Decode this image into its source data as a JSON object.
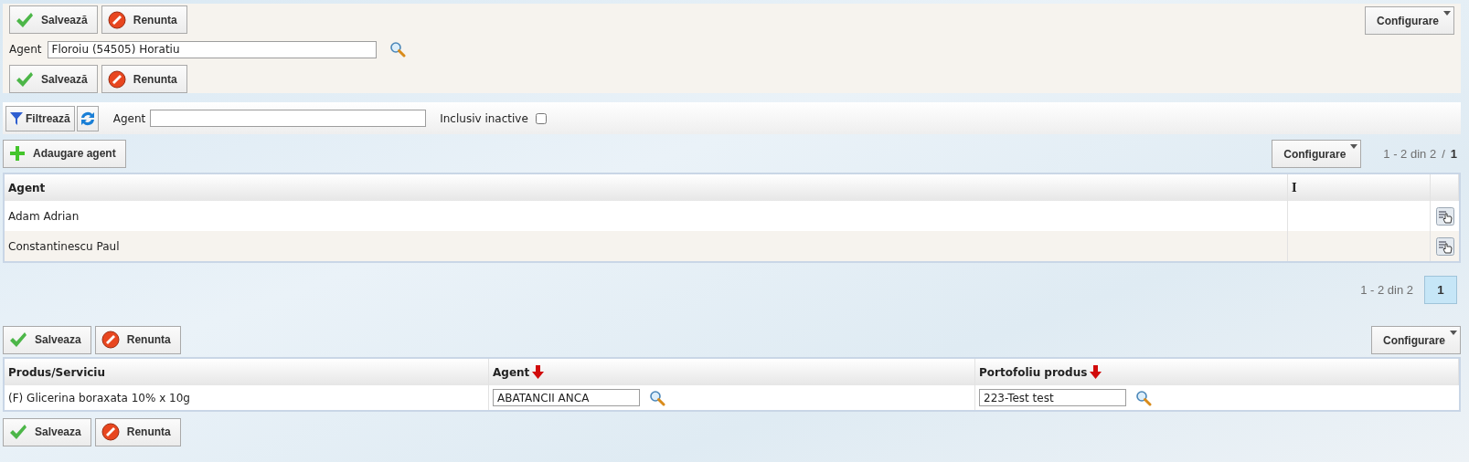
{
  "agent_form": {
    "toolbar_top": [
      {
        "kind": "save",
        "label": "Salvează"
      },
      {
        "kind": "cancel",
        "label": "Renunta"
      }
    ],
    "agent_label": "Agent",
    "agent_value": "Floroiu (54505) Horatiu",
    "configure": "Configurare",
    "toolbar_bottom": [
      {
        "kind": "save",
        "label": "Salvează"
      },
      {
        "kind": "cancel",
        "label": "Renunta"
      }
    ]
  },
  "filter_bar": {
    "filter_button": "Filtrează",
    "agent_label": "Agent",
    "inactive_label": "Inclusiv inactive",
    "inactive_checked": false
  },
  "agents_list": {
    "add_button": "Adaugare agent",
    "configure": "Configurare",
    "pager_top": {
      "range": "1 - 2 din 2",
      "separator": "/",
      "page": "1"
    },
    "columns": [
      "Agent",
      "I"
    ],
    "rows": [
      {
        "agent": "Adam Adrian"
      },
      {
        "agent": "Constantinescu Paul"
      }
    ],
    "pager_bottom": {
      "range": "1 - 2 din 2",
      "pages": [
        {
          "label": "1",
          "selected": true
        }
      ]
    }
  },
  "portfolio": {
    "toolbar_top": [
      {
        "kind": "save",
        "label": "Salveaza"
      },
      {
        "kind": "cancel",
        "label": "Renunta"
      }
    ],
    "configure": "Configurare",
    "columns": [
      {
        "label": "Produs/Serviciu",
        "marked": false
      },
      {
        "label": "Agent",
        "marked": true
      },
      {
        "label": "Portofoliu produs",
        "marked": true
      }
    ],
    "rows": [
      {
        "product": "(F) Glicerina boraxata 10% x 10g",
        "agent": "ABATANCII ANCA",
        "portfolio": "223-Test test"
      }
    ],
    "toolbar_bottom": [
      {
        "kind": "save",
        "label": "Salveaza"
      },
      {
        "kind": "cancel",
        "label": "Renunta"
      }
    ]
  }
}
